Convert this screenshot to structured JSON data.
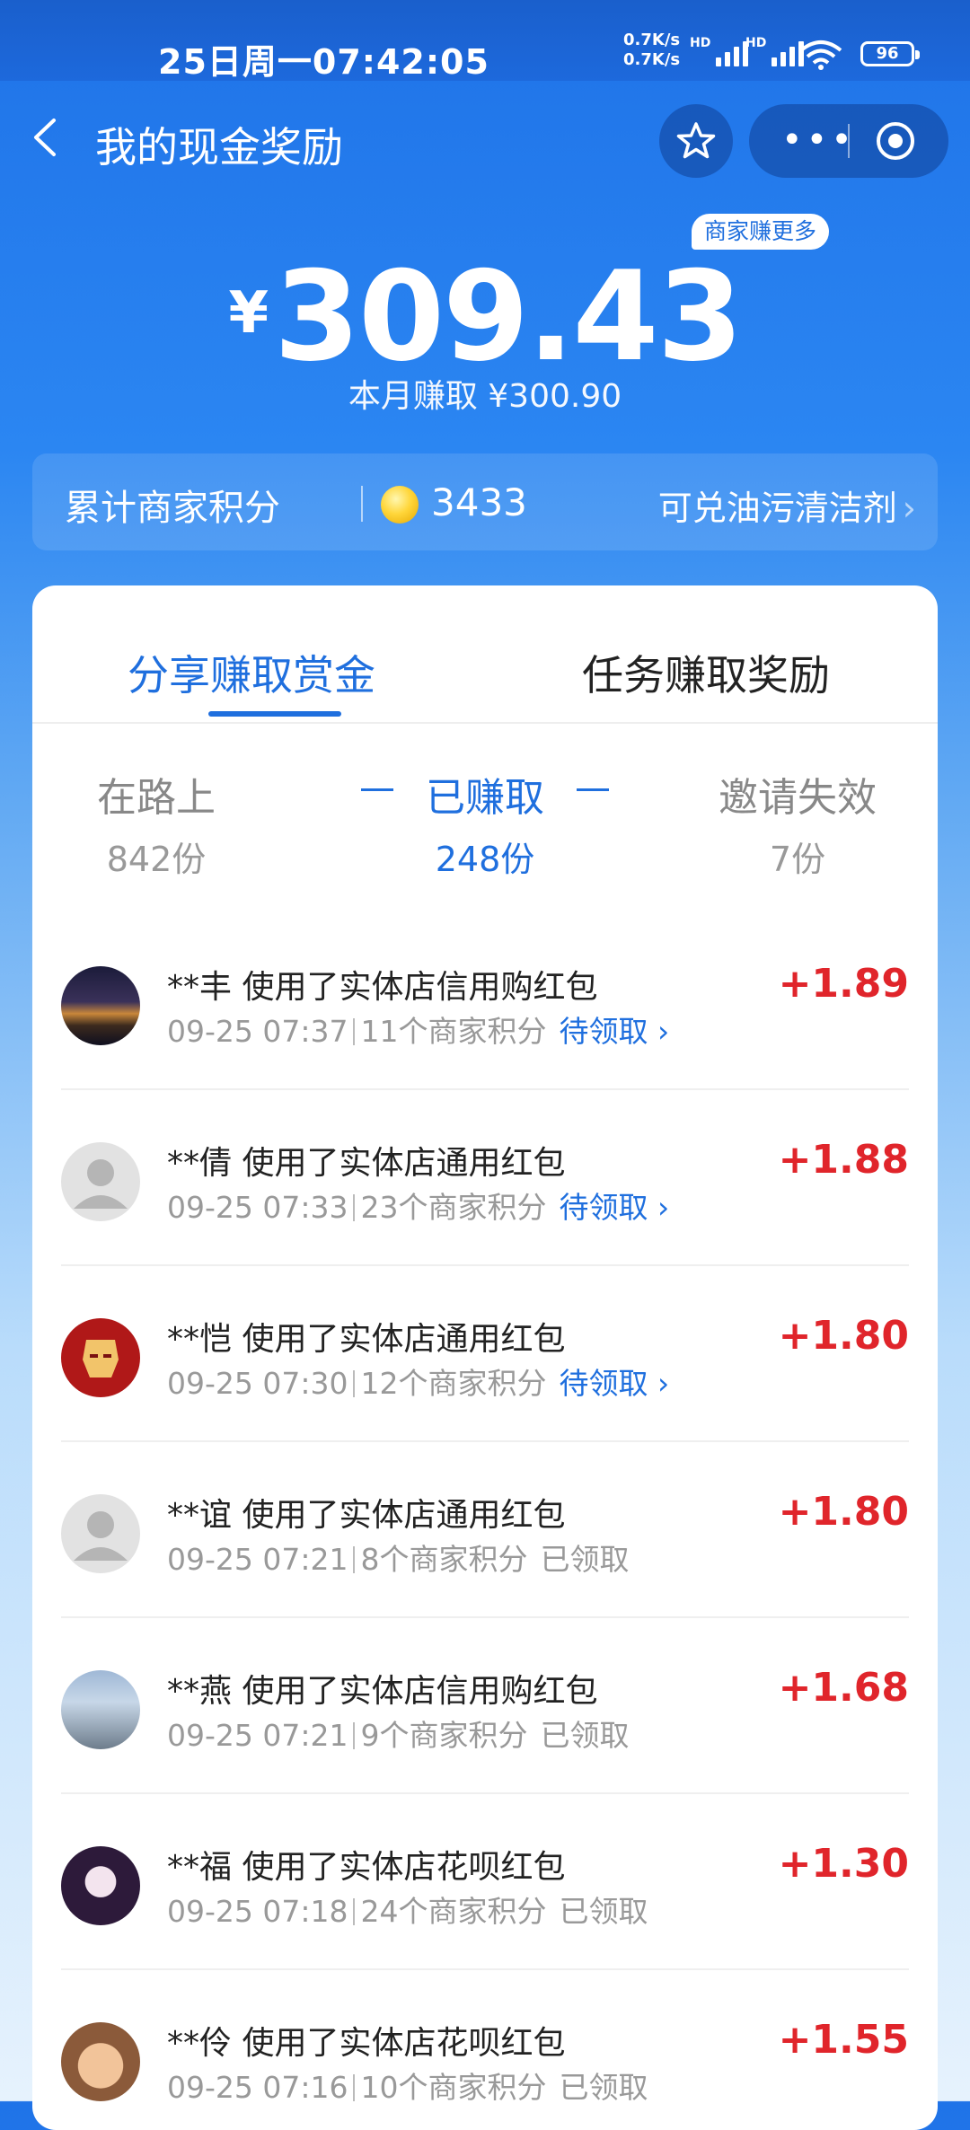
{
  "status_bar": {
    "time": "25日周一07:42:05",
    "up_speed": "0.7K/s",
    "down_speed": "0.7K/s",
    "hd1": "HD",
    "hd2": "HD",
    "battery": "96"
  },
  "nav": {
    "title": "我的现金奖励",
    "more": "•••"
  },
  "header": {
    "merchant_more": "商家赚更多",
    "currency": "¥",
    "balance": "309.43",
    "month_earned": "本月赚取 ¥300.90"
  },
  "points_bar": {
    "label": "累计商家积分",
    "value": "3433",
    "redeem": "可兑油污清洁剂"
  },
  "tabs": [
    {
      "label": "分享赚取赏金",
      "active": true
    },
    {
      "label": "任务赚取奖励",
      "active": false
    }
  ],
  "stats": [
    {
      "label": "在路上",
      "count": "842份"
    },
    {
      "label": "已赚取",
      "count": "248份",
      "active": true
    },
    {
      "label": "邀请失效",
      "count": "7份"
    }
  ],
  "records": [
    {
      "title": "**丰 使用了实体店信用购红包",
      "time": "09-25 07:37",
      "points": "11个商家积分",
      "status": "待领取",
      "amount": "+1.89",
      "avatar": "city-night-avatar"
    },
    {
      "title": "**倩 使用了实体店通用红包",
      "time": "09-25 07:33",
      "points": "23个商家积分",
      "status": "待领取",
      "amount": "+1.88",
      "avatar": "default-user-avatar"
    },
    {
      "title": "**恺 使用了实体店通用红包",
      "time": "09-25 07:30",
      "points": "12个商家积分",
      "status": "待领取",
      "amount": "+1.80",
      "avatar": "iron-man-avatar"
    },
    {
      "title": "**谊 使用了实体店通用红包",
      "time": "09-25 07:21",
      "points": "8个商家积分",
      "status": "已领取",
      "amount": "+1.80",
      "avatar": "default-user-avatar"
    },
    {
      "title": "**燕 使用了实体店信用购红包",
      "time": "09-25 07:21",
      "points": "9个商家积分",
      "status": "已领取",
      "amount": "+1.68",
      "avatar": "city-tower-avatar"
    },
    {
      "title": "**福 使用了实体店花呗红包",
      "time": "09-25 07:18",
      "points": "24个商家积分",
      "status": "已领取",
      "amount": "+1.30",
      "avatar": "anime-girl-avatar"
    },
    {
      "title": "**伶 使用了实体店花呗红包",
      "time": "09-25 07:16",
      "points": "10个商家积分",
      "status": "已领取",
      "amount": "+1.55",
      "avatar": "baby-photo-avatar"
    }
  ],
  "colors": {
    "primary": "#1f6fde",
    "amount_red": "#e0252b"
  }
}
